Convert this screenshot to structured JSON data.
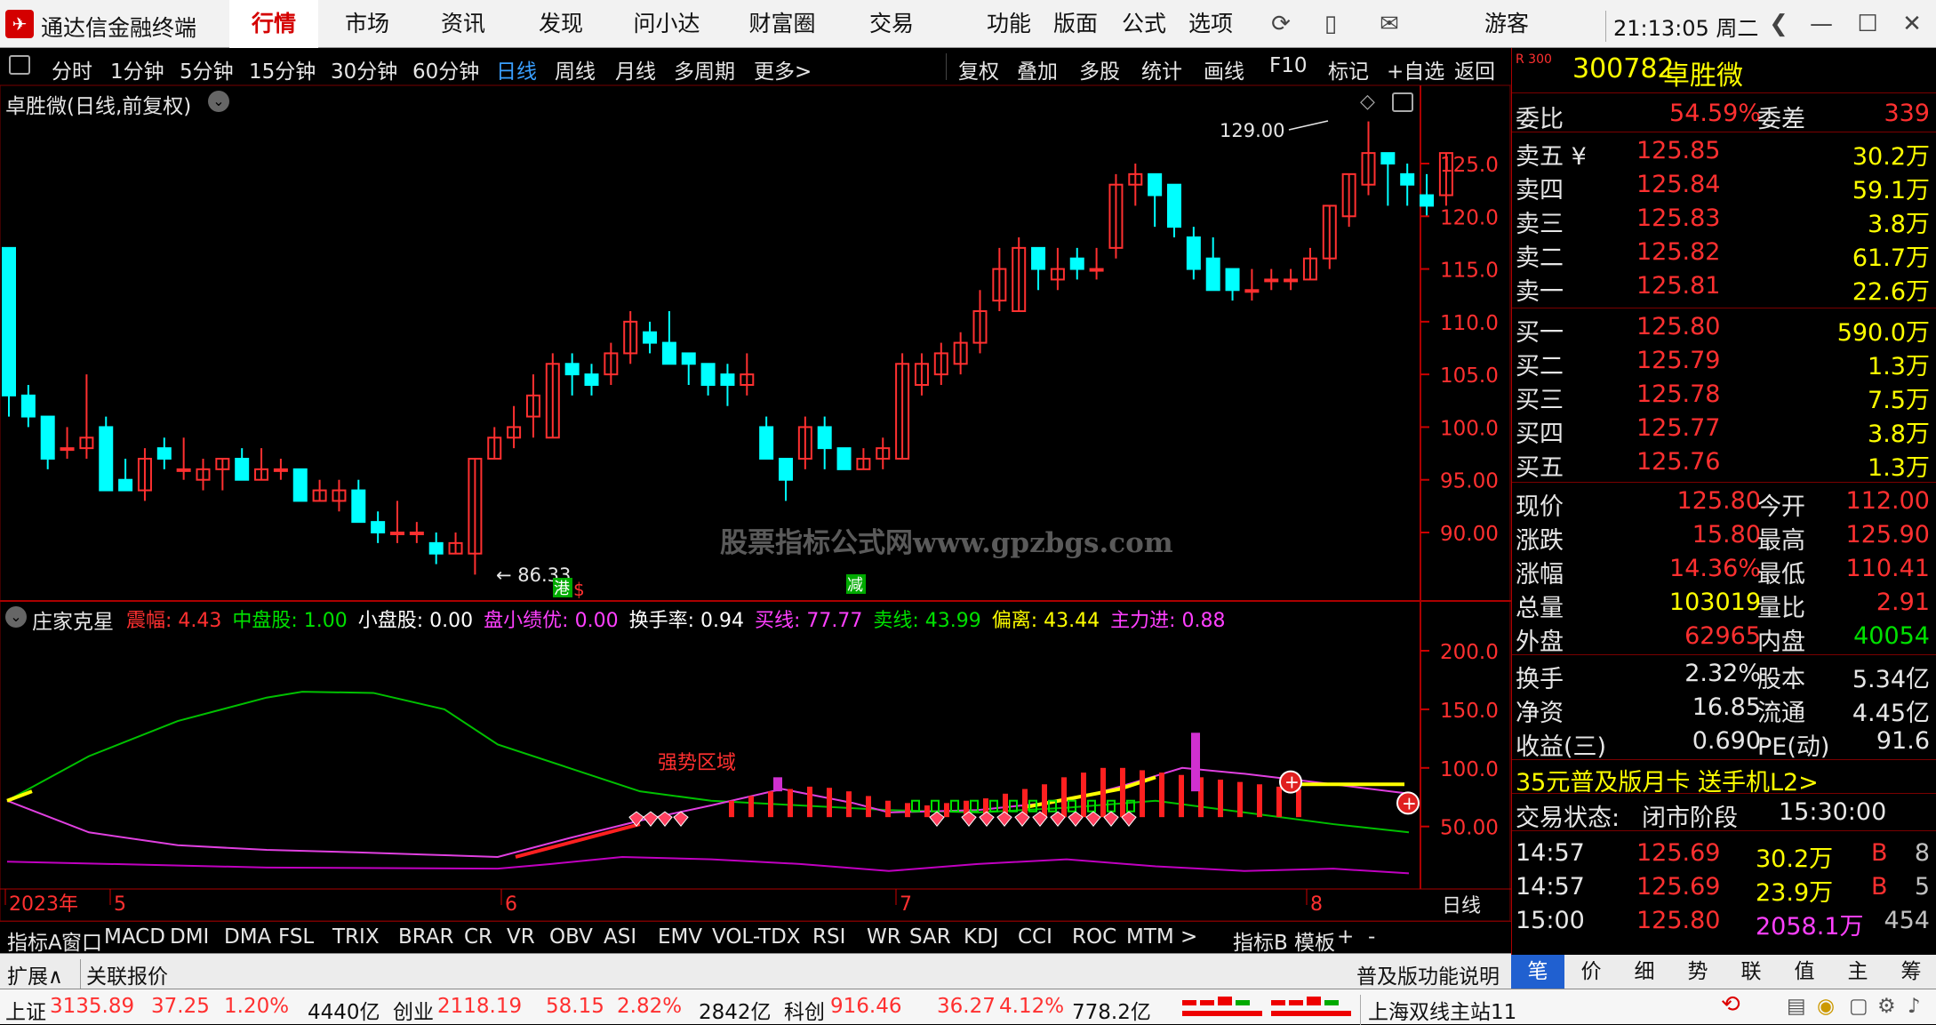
{
  "titlebar": {
    "app_name": "通达信金融终端",
    "menus": [
      "行情",
      "市场",
      "资讯",
      "发现",
      "问小达",
      "财富圈",
      "交易"
    ],
    "active_menu": "行情",
    "right_menus": [
      "功能",
      "版面",
      "公式",
      "选项"
    ],
    "user": "游客",
    "clock": "21:13:05 周二"
  },
  "periodbar": {
    "items": [
      "分时",
      "1分钟",
      "5分钟",
      "15分钟",
      "30分钟",
      "60分钟",
      "日线",
      "周线",
      "月线",
      "多周期",
      "更多>"
    ],
    "active": "日线",
    "right_items": [
      "复权",
      "叠加",
      "多股",
      "统计",
      "画线",
      "F10",
      "标记",
      "+自选",
      "返回"
    ]
  },
  "chart_header": {
    "title": "卓胜微(日线,前复权)"
  },
  "watermark": "股票指标公式网www.gpzbgs.com",
  "main_chart": {
    "high_label": "129.00",
    "low_label": "86.33",
    "markers": [
      "港",
      "$",
      "减"
    ],
    "y_axis": [
      "125.0",
      "120.0",
      "115.0",
      "110.0",
      "105.0",
      "100.0",
      "95.00",
      "90.00"
    ]
  },
  "indicator_header": {
    "name": "庄家克星",
    "fields": [
      {
        "label": "震幅:",
        "value": "4.43",
        "color": "#ff3030"
      },
      {
        "label": "中盘股:",
        "value": "1.00",
        "color": "#00e000"
      },
      {
        "label": "小盘股:",
        "value": "0.00",
        "color": "#ffffff"
      },
      {
        "label": "盘小绩优:",
        "value": "0.00",
        "color": "#ff40ff"
      },
      {
        "label": "换手率:",
        "value": "0.94",
        "color": "#ffffff"
      },
      {
        "label": "买线:",
        "value": "77.77",
        "color": "#ff40ff"
      },
      {
        "label": "卖线:",
        "value": "43.99",
        "color": "#00e000"
      },
      {
        "label": "偏离:",
        "value": "43.44",
        "color": "#ffff00"
      },
      {
        "label": "主力进:",
        "value": "0.88",
        "color": "#ff40ff"
      }
    ]
  },
  "indicator_chart": {
    "annotation": "强势区域",
    "y_axis": [
      "200.0",
      "150.0",
      "100.0",
      "50.00"
    ]
  },
  "date_axis": {
    "labels": [
      "2023年",
      "5",
      "6",
      "7",
      "8"
    ],
    "period": "日线"
  },
  "bottom_tabs": [
    "指标A",
    "窗口",
    "MACD",
    "DMI",
    "DMA",
    "FSL",
    "TRIX",
    "BRAR",
    "CR",
    "VR",
    "OBV",
    "ASI",
    "EMV",
    "VOL-TDX",
    "RSI",
    "WR",
    "SAR",
    "KDJ",
    "CCI",
    "ROC",
    "MTM",
    ">",
    "指标B",
    "模板",
    "+",
    "-"
  ],
  "ext_bar": {
    "left": [
      "扩展∧",
      "关联报价"
    ],
    "right_label": "普及版功能说明",
    "tabs": [
      "笔",
      "价",
      "细",
      "势",
      "联",
      "值",
      "主",
      "筹"
    ]
  },
  "quote": {
    "exchange_badge": "R\n300",
    "code": "300782",
    "name": "卓胜微",
    "weibi_label": "委比",
    "weibi": "54.59%",
    "weicha_label": "委差",
    "weicha": "339",
    "asks": [
      {
        "label": "卖五",
        "price": "125.85",
        "vol": "30.2万"
      },
      {
        "label": "卖四",
        "price": "125.84",
        "vol": "59.1万"
      },
      {
        "label": "卖三",
        "price": "125.83",
        "vol": "3.8万"
      },
      {
        "label": "卖二",
        "price": "125.82",
        "vol": "61.7万"
      },
      {
        "label": "卖一",
        "price": "125.81",
        "vol": "22.6万"
      }
    ],
    "bids": [
      {
        "label": "买一",
        "price": "125.80",
        "vol": "590.0万"
      },
      {
        "label": "买二",
        "price": "125.79",
        "vol": "1.3万"
      },
      {
        "label": "买三",
        "price": "125.78",
        "vol": "7.5万"
      },
      {
        "label": "买四",
        "price": "125.77",
        "vol": "3.8万"
      },
      {
        "label": "买五",
        "price": "125.76",
        "vol": "1.3万"
      }
    ],
    "stats": [
      {
        "l1": "现价",
        "v1": "125.80",
        "c1": "#ff3030",
        "l2": "今开",
        "v2": "112.00",
        "c2": "#ff3030"
      },
      {
        "l1": "涨跌",
        "v1": "15.80",
        "c1": "#ff3030",
        "l2": "最高",
        "v2": "125.90",
        "c2": "#ff3030"
      },
      {
        "l1": "涨幅",
        "v1": "14.36%",
        "c1": "#ff3030",
        "l2": "最低",
        "v2": "110.41",
        "c2": "#ff3030"
      },
      {
        "l1": "总量",
        "v1": "103019",
        "c1": "#ffff00",
        "l2": "量比",
        "v2": "2.91",
        "c2": "#ff3030"
      },
      {
        "l1": "外盘",
        "v1": "62965",
        "c1": "#ff3030",
        "l2": "内盘",
        "v2": "40054",
        "c2": "#00e000"
      }
    ],
    "stats2": [
      {
        "l1": "换手",
        "v1": "2.32%",
        "l2": "股本",
        "v2": "5.34亿"
      },
      {
        "l1": "净资",
        "v1": "16.85",
        "l2": "流通",
        "v2": "4.45亿"
      },
      {
        "l1": "收益(三)",
        "v1": "0.690",
        "l2": "PE(动)",
        "v2": "91.6"
      }
    ],
    "promo": "35元普及版月卡 送手机L2>",
    "trade_status_label": "交易状态:",
    "trade_status": "闭市阶段",
    "trade_time": "15:30:00",
    "ticks": [
      {
        "t": "14:57",
        "p": "125.69",
        "v": "30.2万",
        "side": "B",
        "n": "8"
      },
      {
        "t": "14:57",
        "p": "125.69",
        "v": "23.9万",
        "side": "B",
        "n": "5"
      },
      {
        "t": "15:00",
        "p": "125.80",
        "v": "2058.1万",
        "side": "",
        "n": "454"
      }
    ]
  },
  "statusbar": {
    "items": [
      {
        "name": "上证",
        "value": "3135.89",
        "chg": "37.25",
        "pct": "1.20%",
        "amt": "4440亿"
      },
      {
        "name": "创业",
        "value": "2118.19",
        "chg": "58.15",
        "pct": "2.82%",
        "amt": "2842亿"
      },
      {
        "name": "科创",
        "value": "916.46",
        "chg": "36.27",
        "pct": "4.12%",
        "amt": "778.2亿"
      }
    ],
    "server": "上海双线主站11"
  },
  "colors": {
    "up": "#ff3030",
    "down": "#00ffff",
    "ma_green": "#00c000",
    "ma_magenta": "#e040e0",
    "grid_red": "#7a0000",
    "yellow": "#ffff00"
  }
}
